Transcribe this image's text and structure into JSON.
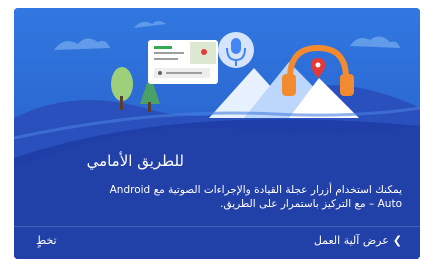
{
  "onboarding": {
    "title": "للطريق الأمامي",
    "body_line1": "يمكنك استخدام أزرار عجلة القيادة والإجراءات الصوتية مع Android",
    "body_line2": "Auto – مع التركيز باستمرار على الطريق.",
    "how_it_works_label": "عرض آلية العمل",
    "skip_label": "تخطٍ",
    "chevron_icon": "chevron-left-icon"
  },
  "colors": {
    "sky": "#2d6ed8",
    "ground": "#1f3ea8",
    "hill": "#2b56c4",
    "mic_blue": "#3b82f5",
    "headphone_orange": "#f28b30",
    "pin_red": "#e53935",
    "tree_green": "#7cc25b"
  }
}
